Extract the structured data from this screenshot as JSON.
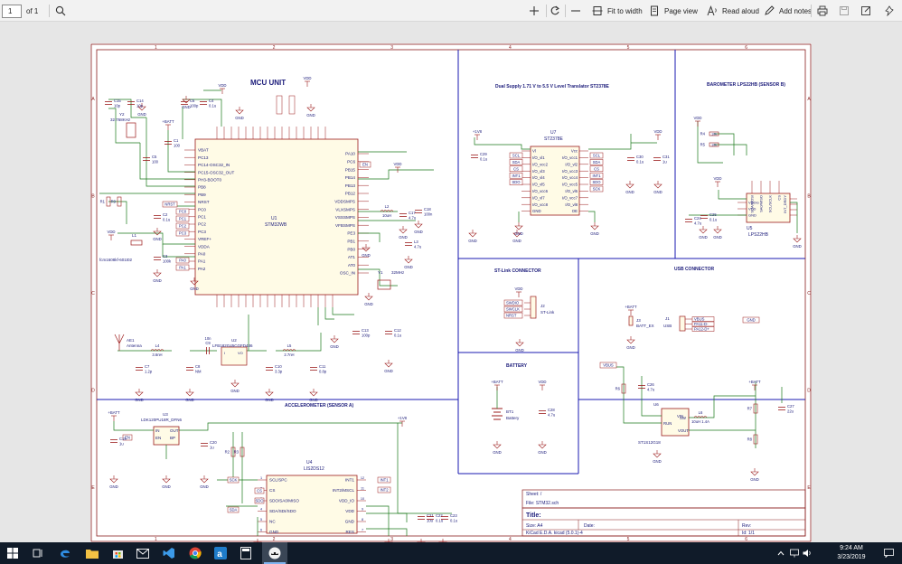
{
  "viewer": {
    "page_number": "1",
    "page_count": "of 1",
    "fit_to_width": "Fit to width",
    "page_view": "Page view",
    "read_aloud": "Read aloud",
    "add_notes": "Add notes"
  },
  "taskbar": {
    "time": "9:24 AM",
    "date": "3/23/2019"
  },
  "schematic": {
    "colors": {
      "wire": "#1b7a1b",
      "part": "#9b1b1b",
      "border": "#8a1f1f",
      "frame": "#1a1ab0",
      "text": "#1b1b7a"
    },
    "column_numbers": [
      "1",
      "2",
      "3",
      "4",
      "5",
      "6"
    ],
    "row_letters": [
      "A",
      "B",
      "C",
      "D",
      "E"
    ],
    "sections": {
      "mcu": "MCU UNIT",
      "translator": "Dual Supply 1.71 V to 5.5 V Level Translator ST2378E",
      "barometer": "BAROMETER LPS22HB (SENSOR B)",
      "stlink": "ST-Link CONNECTOR",
      "usb": "USB CONNECTOR",
      "battery": "BATTERY",
      "accelerometer": "ACCELEROMETER (SENSOR A)"
    },
    "u1": {
      "ref": "U1",
      "value": "STM32WB",
      "left_pins": [
        "VBAT",
        "PC13",
        "PC14-OSC32_IN",
        "PC15-OSC32_OUT",
        "PH3-BOOT0",
        "PB8",
        "PB9",
        "NRST",
        "PC0",
        "PC1",
        "PC2",
        "PC3",
        "VREF+",
        "VDDA",
        "PA0",
        "PA1",
        "PA2"
      ],
      "right_pins": [
        "PA10",
        "PC6",
        "PB15",
        "PB14",
        "PB13",
        "PB12",
        "VDDSMPS",
        "VLXSMPS",
        "VSSSMPS",
        "VFBSMPS",
        "PE3",
        "PB1",
        "PB0",
        "AT1",
        "AT0",
        "OSC_IN"
      ]
    },
    "u7": {
      "ref": "U7",
      "value": "ST2378E",
      "left_pins": [
        "Vl",
        "I/O_vl1",
        "I/O_vcc2",
        "I/O_vl3",
        "I/O_vl4",
        "I/O_vl5",
        "I/O_vcc6",
        "I/O_vl7",
        "I/O_vcc8",
        "GND"
      ],
      "right_pins": [
        "Vcc",
        "I/O_vcc1",
        "I/O_vl2",
        "I/O_vcc3",
        "I/O_vcc4",
        "I/O_vcc5",
        "I/O_vl6",
        "I/O_vcc7",
        "I/O_vl8",
        "OE"
      ]
    },
    "u5": {
      "ref": "U5",
      "value": "LPS22HB",
      "top_pins": [
        "SDA/MOSI",
        "SA0/MISO",
        "SCL/SCLK",
        "CS"
      ],
      "left_pins": [
        "VDDIo",
        "VDD",
        "GND"
      ],
      "right_pins": [
        "INT_DRDY",
        "",
        "",
        ""
      ]
    },
    "u4": {
      "ref": "U4",
      "value": "LIS2DS12",
      "left_pins": [
        "SCL/SPC",
        "CS",
        "SDO/SA0/MISO",
        "SDA/SDI/SDO",
        "NC",
        "GND"
      ],
      "right_pins": [
        "INT1",
        "INT2/MSCL",
        "VDD_IO",
        "VDD",
        "GND",
        "RES"
      ],
      "left_nums": [
        "1",
        "2",
        "3",
        "4",
        "5",
        "6"
      ],
      "right_nums": [
        "12",
        "11",
        "10",
        "9",
        "8",
        "7"
      ]
    },
    "u3": {
      "ref": "U3",
      "value": "LDK120PU18R_DFN6",
      "pins": [
        "IN",
        "EN",
        "OUT",
        "BP"
      ]
    },
    "u2": {
      "ref": "U2",
      "value": "LFB182G45CGFD436",
      "pin_left": "I",
      "pin_right": "VO"
    },
    "u6": {
      "ref": "U6",
      "value": "ST1S12G18",
      "pins": [
        "VIN",
        "RUN",
        "SW",
        "VOUT"
      ]
    },
    "j2": {
      "ref": "J2",
      "value": "ST-Link",
      "pins": [
        "SWDIO",
        "SWCLK",
        "NRST"
      ]
    },
    "j1": {
      "ref": "J1",
      "value": "USB",
      "pins": [
        "VBUS",
        "PA11-D-",
        "PA12-D+"
      ]
    },
    "j3": {
      "ref": "J3",
      "value": "BATT_EX"
    },
    "bt1": {
      "ref": "BT1",
      "value": "Battery"
    },
    "y1": {
      "ref": "Y1",
      "value": "32MHz"
    },
    "y2": {
      "ref": "Y2",
      "value": "32.768KHz"
    },
    "l1": {
      "ref": "L1",
      "value": "fcm1608kf-601t02"
    },
    "ae1": {
      "ref": "AE1",
      "value": "Antenna"
    },
    "power": {
      "vdd": "VDD",
      "batt": "+BATT",
      "v18": "+1V8",
      "gnd": "GND",
      "vbus": "VBUS",
      "usb_gnd": "GND"
    },
    "labels": {
      "en": "EN",
      "nrst": "NRST",
      "sck": "SCK",
      "sda": "SDA",
      "cs": "CS",
      "int1": "INT1",
      "int2": "INT2",
      "sdo": "SDO"
    },
    "passives": [
      {
        "ref": "C15",
        "val": "10p"
      },
      {
        "ref": "C14",
        "val": "10p"
      },
      {
        "ref": "C6",
        "val": "100p"
      },
      {
        "ref": "C4",
        "val": "0.1u"
      },
      {
        "ref": "C5",
        "val": "100"
      },
      {
        "ref": "C1",
        "val": "100"
      },
      {
        "ref": "C2",
        "val": "0.1u"
      },
      {
        "ref": "C3",
        "val": "100k"
      },
      {
        "ref": "C17",
        "val": "4.7u"
      },
      {
        "ref": "C18",
        "val": "100n"
      },
      {
        "ref": "L2",
        "val": "10uH"
      },
      {
        "ref": "L3",
        "val": "4.7u"
      },
      {
        "ref": "C12",
        "val": "0.1u"
      },
      {
        "ref": "C13",
        "val": "100p"
      },
      {
        "ref": "C7",
        "val": "1.2p"
      },
      {
        "ref": "C8",
        "val": "NM"
      },
      {
        "ref": "C9",
        "val": "10n"
      },
      {
        "ref": "C10",
        "val": "3.3p"
      },
      {
        "ref": "C11",
        "val": "0.8p"
      },
      {
        "ref": "C29",
        "val": "0.1u"
      },
      {
        "ref": "C30",
        "val": "0.1u"
      },
      {
        "ref": "C31",
        "val": "1u"
      },
      {
        "ref": "C24",
        "val": "4.7u"
      },
      {
        "ref": "C25",
        "val": "0.1u"
      },
      {
        "ref": "C26",
        "val": "4.7u"
      },
      {
        "ref": "C27",
        "val": "22u"
      },
      {
        "ref": "C28",
        "val": "4.7u"
      },
      {
        "ref": "C19",
        "val": "1u"
      },
      {
        "ref": "C20",
        "val": "1u"
      },
      {
        "ref": "C21",
        "val": "10u"
      },
      {
        "ref": "C22",
        "val": "0.1u"
      },
      {
        "ref": "C23",
        "val": "0.1u"
      },
      {
        "ref": "R1",
        "val": ""
      },
      {
        "ref": "R2",
        "val": ""
      },
      {
        "ref": "R3",
        "val": ""
      },
      {
        "ref": "R4",
        "val": "10k"
      },
      {
        "ref": "R5",
        "val": "10k"
      },
      {
        "ref": "R6",
        "val": ""
      },
      {
        "ref": "R7",
        "val": ""
      },
      {
        "ref": "R8",
        "val": ""
      },
      {
        "ref": "R9",
        "val": ""
      },
      {
        "ref": "L4",
        "val": "3.6nH"
      },
      {
        "ref": "L5",
        "val": "2.7nH"
      },
      {
        "ref": "L6",
        "val": "10uH 1.4A"
      }
    ],
    "title_block": {
      "sheet": "Sheet: /",
      "file": "File: STM32.sch",
      "title": "Title:",
      "size": "Size: A4",
      "date": "Date:",
      "rev": "Rev:",
      "tool": "KiCad E.D.A.  kicad (5.0.1)-4",
      "id": "Id: 1/1"
    }
  }
}
